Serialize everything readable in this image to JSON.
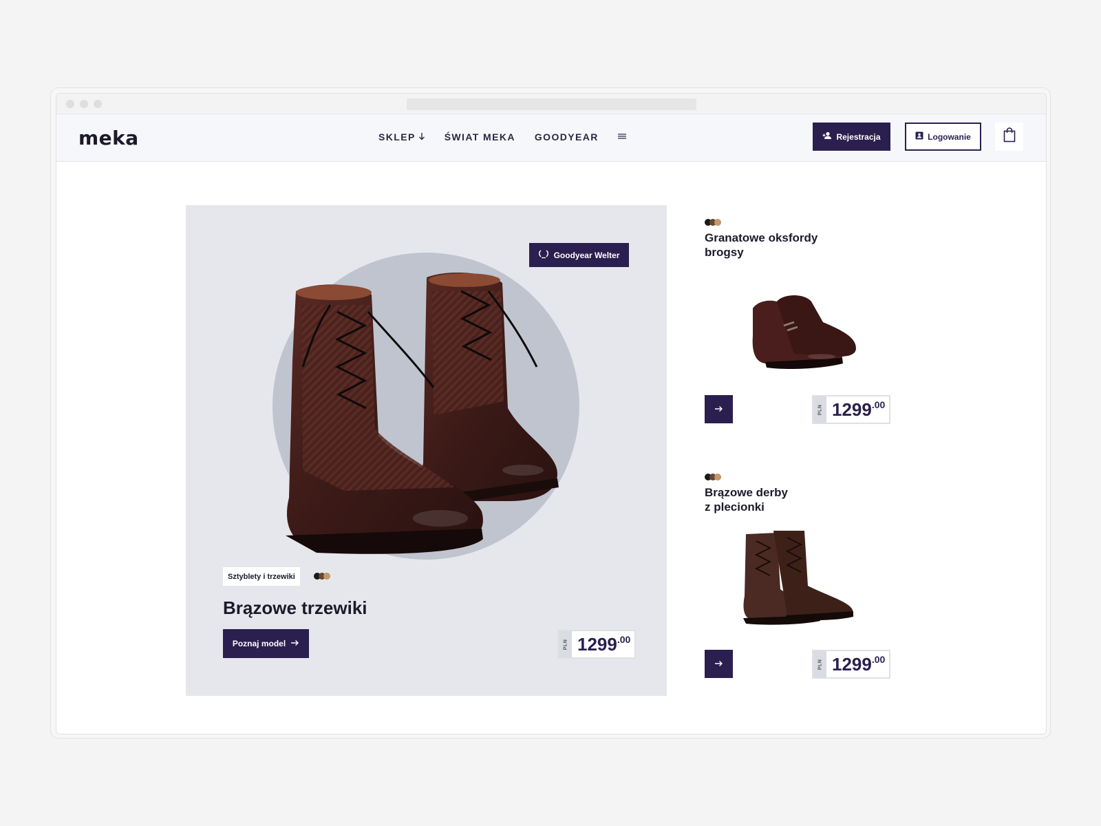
{
  "browser": {
    "url": ""
  },
  "header": {
    "logo": "meka",
    "nav": [
      {
        "label": "SKLEP",
        "has_arrow": true
      },
      {
        "label": "ŚWIAT MEKA"
      },
      {
        "label": "GOODYEAR"
      }
    ],
    "register_label": "Rejestracja",
    "login_label": "Logowanie"
  },
  "featured": {
    "badge": "Goodyear Welter",
    "category": "Sztyblety i trzewiki",
    "title": "Brązowe trzewiki",
    "cta": "Poznaj model",
    "price": {
      "currency": "PLN",
      "main": "1299",
      "cents": ".00"
    },
    "swatch_colors": [
      "#1a1a1a",
      "#6b4530",
      "#c29a6a"
    ]
  },
  "products": [
    {
      "title": "Granatowe oksfordy\nbrogsy",
      "price": {
        "currency": "PLN",
        "main": "1299",
        "cents": ".00"
      },
      "swatch_colors": [
        "#1a1a1a",
        "#6b4530",
        "#c29a6a"
      ]
    },
    {
      "title": "Brązowe derby\nz plecionki",
      "price": {
        "currency": "PLN",
        "main": "1299",
        "cents": ".00"
      },
      "swatch_colors": [
        "#1a1a1a",
        "#6b4530",
        "#c29a6a"
      ]
    }
  ],
  "colors": {
    "brand": "#2a1f4e",
    "card_bg": "#e6e7ec",
    "circle": "#c0c4cf"
  }
}
